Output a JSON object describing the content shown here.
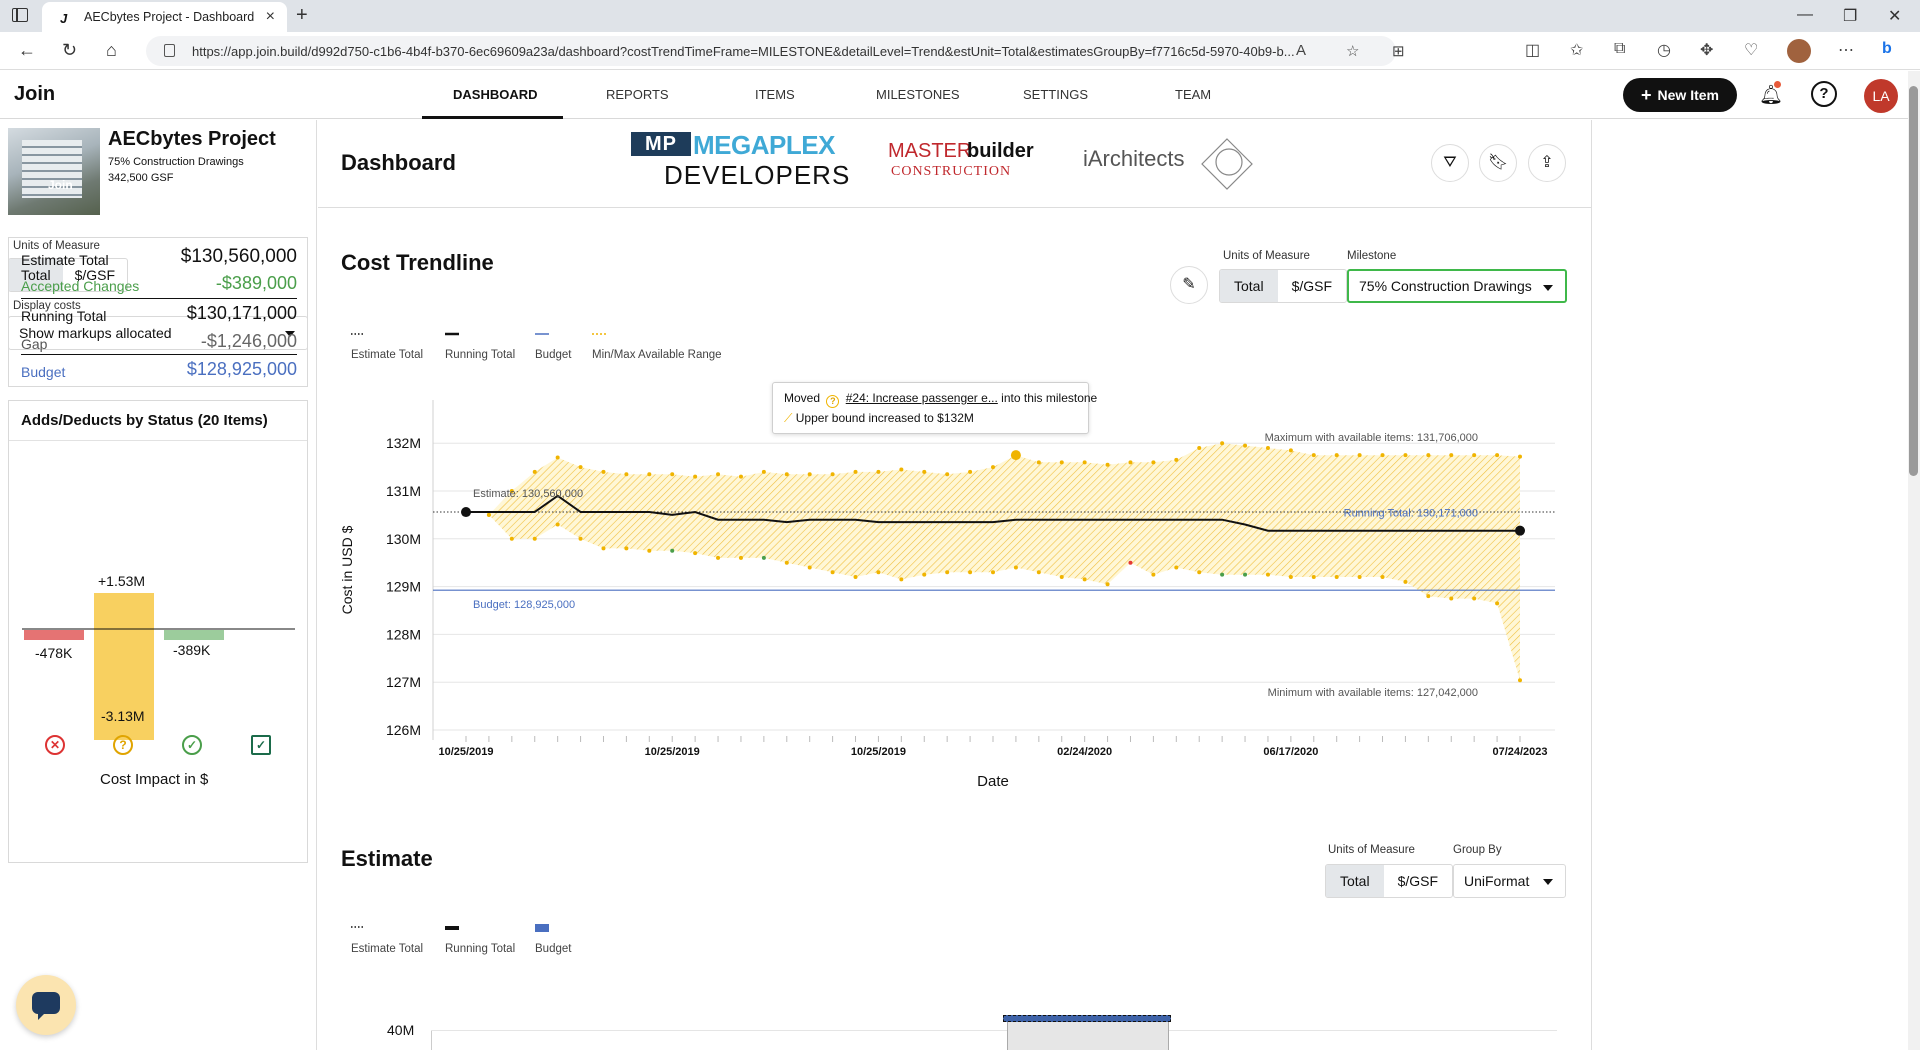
{
  "browser": {
    "tab_title": "AECbytes Project - Dashboard",
    "tab_favicon": "J",
    "url": "https://app.join.build/d992d750-c1b6-4b4f-b370-6ec69609a23a/dashboard?costTrendTimeFrame=MILESTONE&detailLevel=Trend&estUnit=Total&estimatesGroupBy=f7716c5d-5970-40b9-b..."
  },
  "header": {
    "logo": "Join",
    "tabs": [
      "DASHBOARD",
      "REPORTS",
      "ITEMS",
      "MILESTONES",
      "SETTINGS",
      "TEAM"
    ],
    "active_tab": "DASHBOARD",
    "new_item_label": "New Item",
    "avatar_initials": "LA"
  },
  "sidebar": {
    "project_name": "AECbytes Project",
    "project_milestone": "75% Construction Drawings",
    "project_area": "342,500 GSF",
    "image_label": "Join",
    "units_label": "Units of Measure",
    "units": [
      "Total",
      "$/GSF"
    ],
    "display_costs_label": "Display costs",
    "display_costs_value": "Show markups allocated",
    "summary": {
      "estimate_total_label": "Estimate Total",
      "estimate_total": "$130,560,000",
      "accepted_changes_label": "Accepted Changes",
      "accepted_changes": "-$389,000",
      "running_total_label": "Running Total",
      "running_total": "$130,171,000",
      "gap_label": "Gap",
      "gap": "-$1,246,000",
      "budget_label": "Budget",
      "budget": "$128,925,000"
    },
    "adds_deducts": {
      "title": "Adds/Deducts by Status (20 Items)",
      "labels": [
        "-478K",
        "+1.53M",
        "-3.13M",
        "-389K"
      ],
      "footer": "Cost Impact in $"
    }
  },
  "dashboard": {
    "title": "Dashboard",
    "brands": {
      "megaplex_mp": "MP",
      "megaplex_name": "MEGAPLEX",
      "megaplex_sub": "DEVELOPERS",
      "master_1": "MASTER",
      "master_2": "builder",
      "master_sub": "CONSTRUCTION",
      "iarch": "iArchitects"
    }
  },
  "cost_trendline": {
    "title": "Cost Trendline",
    "units_label": "Units of Measure",
    "units": [
      "Total",
      "$/GSF"
    ],
    "milestone_label": "Milestone",
    "milestone_value": "75% Construction Drawings",
    "legend": [
      "Estimate Total",
      "Running Total",
      "Budget",
      "Min/Max Available Range"
    ],
    "tooltip": {
      "moved_prefix": "Moved",
      "item_link": "#24: Increase passenger e...",
      "moved_suffix": "into this milestone",
      "upper": "Upper bound increased to $132M"
    }
  },
  "chart_data": {
    "type": "line",
    "xlabel": "Date",
    "ylabel": "Cost in USD $",
    "ylim": [
      126,
      132.5
    ],
    "y_ticks": [
      "126M",
      "127M",
      "128M",
      "129M",
      "130M",
      "131M",
      "132M"
    ],
    "x_ticks": [
      "10/25/2019",
      "10/25/2019",
      "10/25/2019",
      "02/24/2020",
      "06/17/2020",
      "07/24/2023"
    ],
    "annotations": {
      "estimate": "Estimate: 130,560,000",
      "running": "Running Total: 130,171,000",
      "budget": "Budget: 128,925,000",
      "max": "Maximum with available items: 131,706,000",
      "min": "Minimum with available items: 127,042,000"
    },
    "estimate_total": 130.56,
    "budget": 128.925,
    "series": [
      {
        "name": "Running Total",
        "x": [
          0,
          1,
          2,
          3,
          4,
          5,
          6,
          7,
          8,
          9,
          10,
          11,
          12,
          13,
          14,
          15,
          16,
          17,
          18,
          19,
          20,
          21,
          22,
          23,
          24,
          25,
          26,
          27,
          28,
          29,
          30,
          31,
          32,
          33,
          34,
          35,
          36,
          37,
          38,
          39,
          40,
          41,
          42,
          43,
          44,
          45,
          46
        ],
        "values": [
          130.56,
          130.56,
          130.56,
          130.56,
          130.9,
          130.56,
          130.56,
          130.56,
          130.56,
          130.5,
          130.56,
          130.4,
          130.4,
          130.4,
          130.35,
          130.4,
          130.4,
          130.4,
          130.35,
          130.35,
          130.35,
          130.35,
          130.35,
          130.35,
          130.4,
          130.4,
          130.4,
          130.4,
          130.4,
          130.4,
          130.4,
          130.4,
          130.4,
          130.4,
          130.3,
          130.17,
          130.17,
          130.17,
          130.17,
          130.17,
          130.17,
          130.17,
          130.17,
          130.17,
          130.17,
          130.17,
          130.17
        ]
      },
      {
        "name": "Min/Max Available Range (upper)",
        "x": [
          0,
          1,
          2,
          3,
          4,
          5,
          6,
          7,
          8,
          9,
          10,
          11,
          12,
          13,
          14,
          15,
          16,
          17,
          18,
          19,
          20,
          21,
          22,
          23,
          24,
          25,
          26,
          27,
          28,
          29,
          30,
          31,
          32,
          33,
          34,
          35,
          36,
          37,
          38,
          39,
          40,
          41,
          42,
          43,
          44,
          45,
          46
        ],
        "values": [
          130.56,
          130.5,
          131.0,
          131.4,
          131.7,
          131.5,
          131.4,
          131.35,
          131.35,
          131.35,
          131.3,
          131.35,
          131.3,
          131.4,
          131.35,
          131.35,
          131.35,
          131.4,
          131.4,
          131.45,
          131.4,
          131.35,
          131.4,
          131.5,
          131.75,
          131.6,
          131.6,
          131.6,
          131.55,
          131.6,
          131.6,
          131.65,
          131.9,
          132.0,
          131.95,
          131.9,
          131.85,
          131.75,
          131.75,
          131.75,
          131.75,
          131.75,
          131.75,
          131.75,
          131.75,
          131.75,
          131.72
        ]
      },
      {
        "name": "Min/Max Available Range (lower)",
        "x": [
          0,
          1,
          2,
          3,
          4,
          5,
          6,
          7,
          8,
          9,
          10,
          11,
          12,
          13,
          14,
          15,
          16,
          17,
          18,
          19,
          20,
          21,
          22,
          23,
          24,
          25,
          26,
          27,
          28,
          29,
          30,
          31,
          32,
          33,
          34,
          35,
          36,
          37,
          38,
          39,
          40,
          41,
          42,
          43,
          44,
          45,
          46
        ],
        "values": [
          130.56,
          130.5,
          130.0,
          130.0,
          130.3,
          130.0,
          129.8,
          129.8,
          129.75,
          129.75,
          129.7,
          129.6,
          129.6,
          129.6,
          129.5,
          129.4,
          129.3,
          129.2,
          129.3,
          129.15,
          129.25,
          129.3,
          129.3,
          129.3,
          129.4,
          129.3,
          129.2,
          129.15,
          129.05,
          129.5,
          129.25,
          129.4,
          129.3,
          129.25,
          129.25,
          129.25,
          129.2,
          129.2,
          129.2,
          129.2,
          129.2,
          129.1,
          128.8,
          128.75,
          128.75,
          128.65,
          127.04
        ]
      }
    ]
  },
  "estimate_section": {
    "title": "Estimate",
    "units_label": "Units of Measure",
    "units": [
      "Total",
      "$/GSF"
    ],
    "group_by_label": "Group By",
    "group_by_value": "UniFormat",
    "legend": [
      "Estimate Total",
      "Running Total",
      "Budget"
    ],
    "y_tick": "40M"
  },
  "colors": {
    "accent_green": "#3fb84a",
    "budget_blue": "#4a6fc0",
    "range_gold": "#f0b400",
    "accepted_green": "#4a9e4a",
    "negative_red": "#e06666"
  }
}
